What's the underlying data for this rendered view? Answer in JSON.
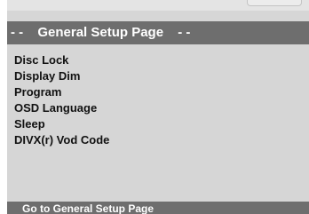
{
  "header": {
    "prefix": "- -",
    "title": "General Setup Page",
    "suffix": "- -"
  },
  "menu": {
    "items": [
      {
        "label": "Disc Lock"
      },
      {
        "label": "Display Dim"
      },
      {
        "label": "Program"
      },
      {
        "label": "OSD Language"
      },
      {
        "label": "Sleep"
      },
      {
        "label": "DIVX(r) Vod Code"
      }
    ]
  },
  "status": {
    "text": "Go to General Setup Page"
  },
  "colors": {
    "panel_background": "#d6d6d6",
    "bar_background": "#6e6e6e",
    "bar_text": "#ffffff",
    "item_text": "#111111"
  }
}
